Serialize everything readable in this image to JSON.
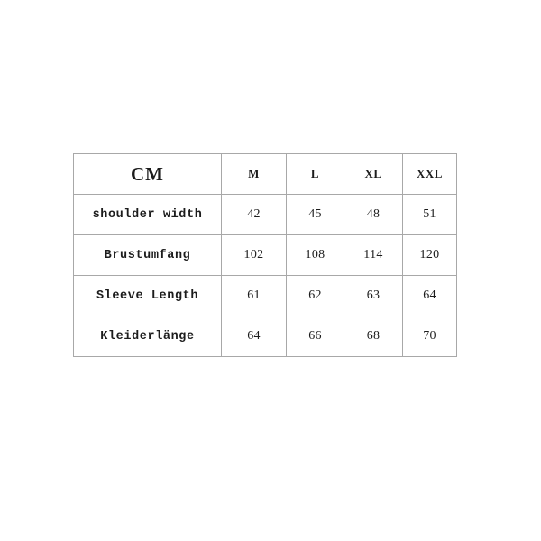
{
  "chart_data": {
    "type": "table",
    "title": "CM",
    "unit_label": "CM",
    "columns": [
      "CM",
      "M",
      "L",
      "XL",
      "XXL"
    ],
    "size_headers": [
      "M",
      "L",
      "XL",
      "XXL"
    ],
    "rows": [
      {
        "label": "shoulder width",
        "values": [
          "42",
          "45",
          "48",
          "51"
        ]
      },
      {
        "label": "Brustumfang",
        "values": [
          "102",
          "108",
          "114",
          "120"
        ]
      },
      {
        "label": "Sleeve Length",
        "values": [
          "61",
          "62",
          "63",
          "64"
        ]
      },
      {
        "label": "Kleiderlänge",
        "values": [
          "64",
          "66",
          "68",
          "70"
        ]
      }
    ],
    "colors": {
      "background": "#ffffff",
      "border": "#a8a8a8",
      "text": "#1c1c1c"
    }
  }
}
